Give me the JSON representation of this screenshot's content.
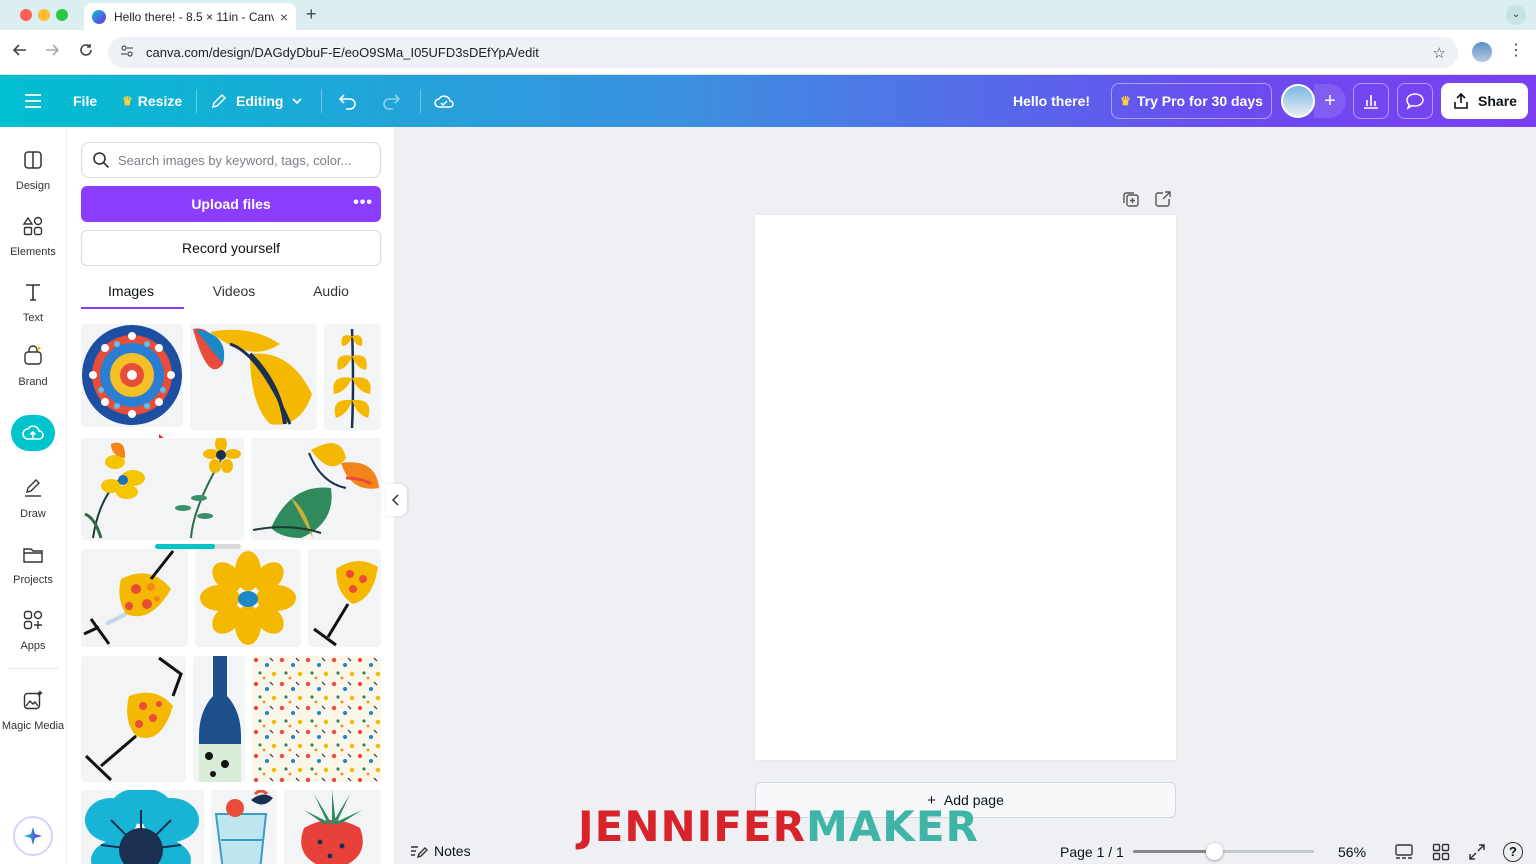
{
  "browser": {
    "tab_title": "Hello there! - 8.5 × 11in - Canva",
    "url": "canva.com/design/DAGdyDbuF-E/eoO9SMa_I05UFD3sDEfYpA/edit",
    "new_tab": "+",
    "close": "×",
    "tab_menu": "⌄"
  },
  "topbar": {
    "file": "File",
    "resize": "Resize",
    "editing": "Editing",
    "design_title": "Hello there!",
    "try_pro": "Try Pro for 30 days",
    "share": "Share",
    "add_collaborator": "+"
  },
  "rail": {
    "items": [
      {
        "label": "Design",
        "icon": "design-icon"
      },
      {
        "label": "Elements",
        "icon": "elements-icon"
      },
      {
        "label": "Text",
        "icon": "text-icon"
      },
      {
        "label": "Brand",
        "icon": "brand-icon"
      },
      {
        "label": "",
        "icon": "uploads-cloud-icon"
      },
      {
        "label": "Draw",
        "icon": "draw-icon"
      },
      {
        "label": "Projects",
        "icon": "projects-icon"
      },
      {
        "label": "Apps",
        "icon": "apps-icon"
      },
      {
        "label": "Magic Media",
        "icon": "magic-media-icon"
      }
    ]
  },
  "uploads": {
    "search_placeholder": "Search images by keyword, tags, color...",
    "upload_button": "Upload files",
    "upload_more": "•••",
    "record_button": "Record yourself",
    "tabs": [
      "Images",
      "Videos",
      "Audio"
    ],
    "active_tab": 0,
    "upload_progress": 0.7
  },
  "canvas": {
    "add_page": "Add page",
    "add_page_plus": "+"
  },
  "bottombar": {
    "notes": "Notes",
    "page_indicator": "Page 1 / 1",
    "zoom": "56%",
    "zoom_fraction": 0.45,
    "help": "?"
  },
  "watermark": {
    "part1": "JENNIFER",
    "part2": "MAKER"
  },
  "colors": {
    "accent": "#8b3dff",
    "teal": "#00c4cc",
    "watermark_red": "#d8232a",
    "watermark_teal": "#3fb5a8"
  }
}
